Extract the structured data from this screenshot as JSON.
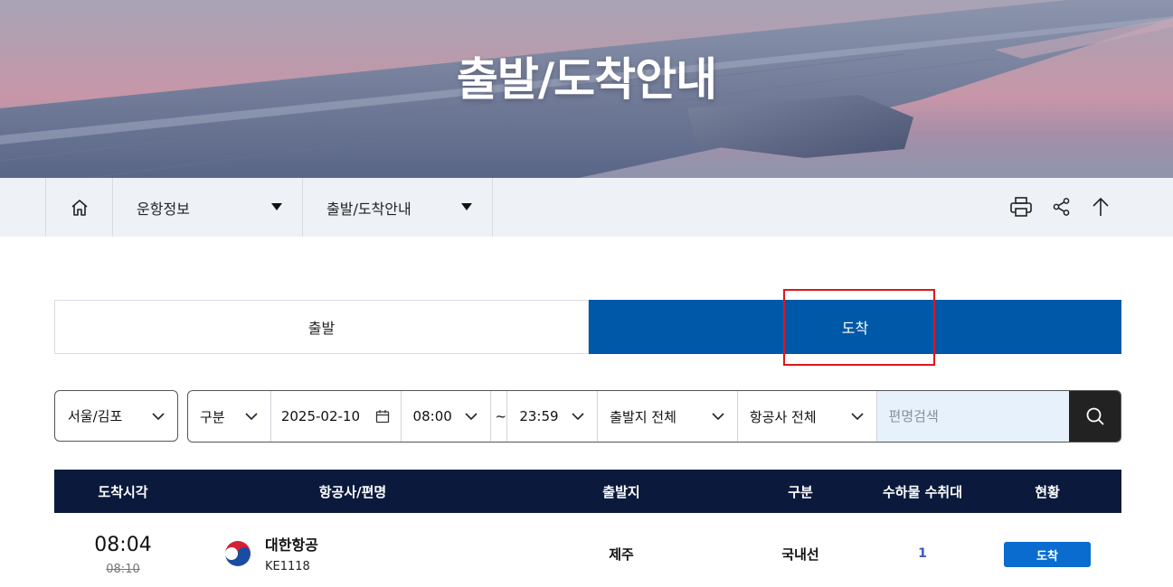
{
  "hero": {
    "title": "출발/도착안내"
  },
  "breadcrumb": {
    "home_icon": "home-icon",
    "menus": [
      {
        "label": "운항정보"
      },
      {
        "label": "출발/도착안내"
      }
    ],
    "tools": [
      "print-icon",
      "share-icon",
      "arrow-up-icon"
    ]
  },
  "tabs": [
    {
      "label": "출발",
      "active": false
    },
    {
      "label": "도착",
      "active": true
    }
  ],
  "filters": {
    "region": "서울/김포",
    "type": "구분",
    "date": "2025-02-10",
    "time_from": "08:00",
    "time_sep": "~",
    "time_to": "23:59",
    "origin": "출발지 전체",
    "airline": "항공사 전체",
    "search_placeholder": "편명검색"
  },
  "table": {
    "headers": [
      "도착시각",
      "항공사/편명",
      "출발지",
      "구분",
      "수하물 수취대",
      "현황"
    ],
    "rows": [
      {
        "time": "08:04",
        "scheduled": "08:10",
        "airline": "대한항공",
        "flight": "KE1118",
        "origin": "제주",
        "type": "국내선",
        "carousel": "1",
        "status": "도착"
      }
    ]
  },
  "colors": {
    "tab_active": "#0059a8",
    "table_header": "#0b1a3c",
    "status_badge": "#0a6ccf",
    "highlight": "#e0161b",
    "search_bg": "#e6f1fc"
  }
}
